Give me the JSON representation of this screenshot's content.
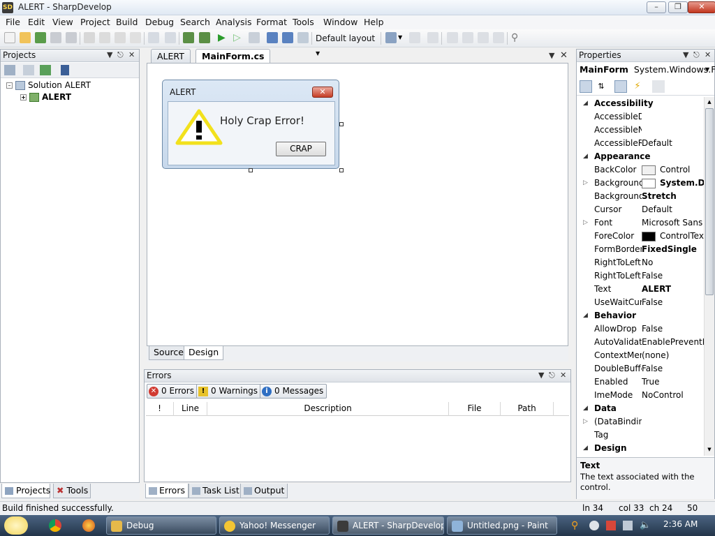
{
  "window": {
    "title": "ALERT - SharpDevelop",
    "app_icon": "SD"
  },
  "menu": [
    "File",
    "Edit",
    "View",
    "Project",
    "Build",
    "Debug",
    "Search",
    "Analysis",
    "Format",
    "Tools",
    "Window",
    "Help"
  ],
  "toolbar": {
    "layout_label": "Default layout"
  },
  "projects": {
    "title": "Projects",
    "tree": {
      "solution": "Solution ALERT",
      "project": "ALERT"
    },
    "tabs": [
      "Projects",
      "Tools"
    ]
  },
  "editor": {
    "tabs": [
      "ALERT",
      "MainForm.cs"
    ],
    "view_tabs": [
      "Source",
      "Design"
    ]
  },
  "form": {
    "title": "ALERT",
    "message": "Holy Crap Error!",
    "button": "CRAP"
  },
  "errors": {
    "title": "Errors",
    "filters": {
      "errors": "0 Errors",
      "warnings": "0 Warnings",
      "messages": "0 Messages"
    },
    "columns": [
      "!",
      "Line",
      "Description",
      "File",
      "Path"
    ],
    "tabs": [
      "Errors",
      "Task List",
      "Output"
    ]
  },
  "properties": {
    "title": "Properties",
    "object_name": "MainForm",
    "object_type": "System.Windows.Fo",
    "rows": [
      {
        "type": "cat",
        "name": "Accessibility"
      },
      {
        "name": "AccessibleD",
        "value": ""
      },
      {
        "name": "AccessibleN",
        "value": ""
      },
      {
        "name": "AccessibleR",
        "value": "Default"
      },
      {
        "type": "cat",
        "name": "Appearance"
      },
      {
        "name": "BackColor",
        "value": "Control",
        "swatch": "#f0f0f0"
      },
      {
        "name": "Background",
        "value": "System.Dra",
        "swatch": "#ffffff",
        "expand": true,
        "bold": true
      },
      {
        "name": "Background",
        "value": "Stretch",
        "bold": true
      },
      {
        "name": "Cursor",
        "value": "Default"
      },
      {
        "name": "Font",
        "value": "Microsoft Sans S",
        "expand": true
      },
      {
        "name": "ForeColor",
        "value": "ControlText",
        "swatch": "#000000"
      },
      {
        "name": "FormBorder",
        "value": "FixedSingle",
        "bold": true
      },
      {
        "name": "RightToLeft",
        "value": "No"
      },
      {
        "name": "RightToLeft",
        "value": "False"
      },
      {
        "name": "Text",
        "value": "ALERT",
        "bold": true
      },
      {
        "name": "UseWaitCur",
        "value": "False"
      },
      {
        "type": "cat",
        "name": "Behavior"
      },
      {
        "name": "AllowDrop",
        "value": "False"
      },
      {
        "name": "AutoValidat",
        "value": "EnablePreventFc"
      },
      {
        "name": "ContextMer",
        "value": "(none)"
      },
      {
        "name": "DoubleBuffe",
        "value": "False"
      },
      {
        "name": "Enabled",
        "value": "True"
      },
      {
        "name": "ImeMode",
        "value": "NoControl"
      },
      {
        "type": "cat",
        "name": "Data"
      },
      {
        "name": "(DataBindin",
        "value": "",
        "expand": true
      },
      {
        "name": "Tag",
        "value": ""
      },
      {
        "type": "cat",
        "name": "Design"
      }
    ],
    "description": {
      "title": "Text",
      "body": "The text associated with the control."
    }
  },
  "status": {
    "message": "Build finished successfully.",
    "line": "ln 34",
    "col": "col 33",
    "ch": "ch 24",
    "extra": "50"
  },
  "taskbar": {
    "tasks": [
      "Debug",
      "Yahoo! Messenger",
      "ALERT - SharpDevelop",
      "Untitled.png - Paint"
    ],
    "clock": "2:36 AM"
  }
}
